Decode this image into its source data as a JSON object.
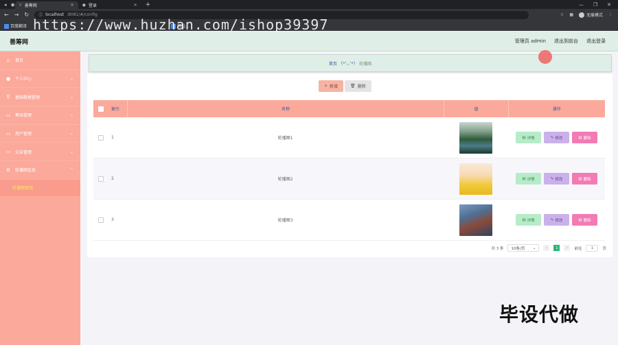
{
  "browser": {
    "tabs": [
      {
        "title": "善筹网"
      },
      {
        "title": "登录"
      }
    ],
    "url_host": "localhost",
    "url_rest": ":8081/#/config",
    "guest_label": "无痕模式",
    "bookmarks": [
      "百度翻译",
      "...",
      "网址...",
      "...",
      "..."
    ]
  },
  "watermark": "https://www.huzhan.com/ishop39397",
  "header": {
    "title": "善筹网",
    "admin": "管理员 admin",
    "back_front": "退出到前台",
    "logout": "退出登录"
  },
  "sidebar": {
    "items": [
      {
        "label": "首页",
        "icon": "home-icon"
      },
      {
        "label": "个人中心",
        "icon": "user-icon"
      },
      {
        "label": "基础数据管理",
        "icon": "pin-icon"
      },
      {
        "label": "筹品管理",
        "icon": "folder-icon"
      },
      {
        "label": "用户管理",
        "icon": "folder-icon"
      },
      {
        "label": "公告管理",
        "icon": "folder-icon"
      },
      {
        "label": "轮播图信息",
        "icon": "settings-icon"
      }
    ],
    "submenu": "轮播图管理"
  },
  "breadcrumb": {
    "home": "首页",
    "face": "(•'◡'•)",
    "current": "轮播图"
  },
  "toolbar": {
    "add": "新增",
    "delete": "删除"
  },
  "table": {
    "headers": {
      "index": "索引",
      "name": "名称",
      "value": "值",
      "ops": "操作"
    },
    "rows": [
      {
        "index": "1",
        "name": "轮播图1"
      },
      {
        "index": "2",
        "name": "轮播图2"
      },
      {
        "index": "3",
        "name": "轮播图3"
      }
    ],
    "ops": {
      "detail": "详情",
      "edit": "修改",
      "delete": "删除"
    }
  },
  "pagination": {
    "total": "共 3 条",
    "page_size": "10条/页",
    "prev": "<",
    "current": "1",
    "next": ">",
    "goto": "前往",
    "goto_value": "1",
    "page_unit": "页"
  },
  "overlay_text": "毕设代做",
  "colors": {
    "sidebar": "#fba99b",
    "header": "#dfeee7",
    "table_head": "#fba99b",
    "detail_btn": "#b6ecc8",
    "edit_btn": "#cbb1ea",
    "delete_btn": "#f27bb4"
  }
}
